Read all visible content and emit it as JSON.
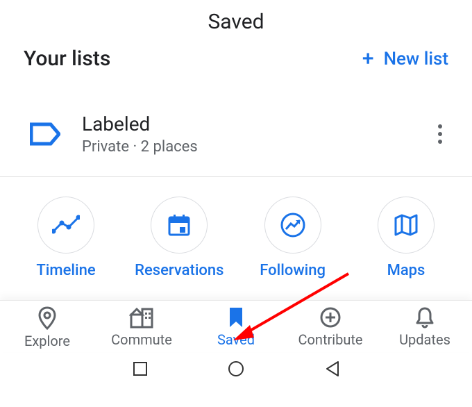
{
  "header": {
    "title": "Saved"
  },
  "section": {
    "heading": "Your lists",
    "new_list_label": "New list"
  },
  "list": {
    "name": "Labeled",
    "subtitle": "Private · 2 places"
  },
  "quick": [
    {
      "label": "Timeline"
    },
    {
      "label": "Reservations"
    },
    {
      "label": "Following"
    },
    {
      "label": "Maps"
    }
  ],
  "nav": [
    {
      "label": "Explore"
    },
    {
      "label": "Commute"
    },
    {
      "label": "Saved"
    },
    {
      "label": "Contribute"
    },
    {
      "label": "Updates"
    }
  ],
  "colors": {
    "accent": "#1a73e8",
    "muted": "#5f6368"
  }
}
